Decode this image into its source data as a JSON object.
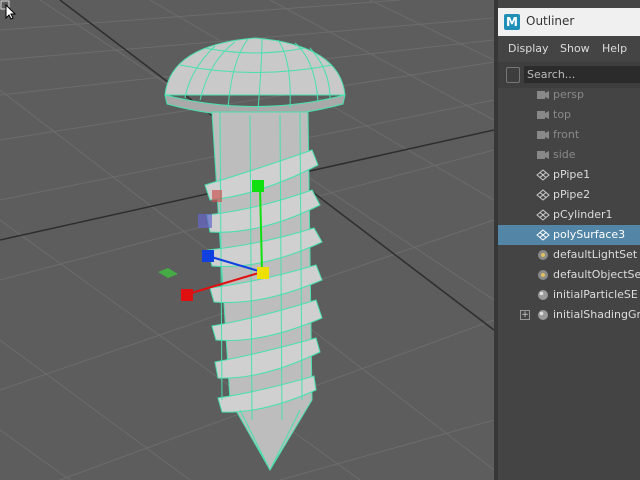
{
  "window": {
    "title": "Outliner",
    "logo_letter": "M"
  },
  "menu": [
    {
      "label": "Display"
    },
    {
      "label": "Show"
    },
    {
      "label": "Help"
    }
  ],
  "search": {
    "placeholder": "Search..."
  },
  "outliner_items": [
    {
      "label": "persp",
      "icon": "camera-icon",
      "type": "camera"
    },
    {
      "label": "top",
      "icon": "camera-icon",
      "type": "camera"
    },
    {
      "label": "front",
      "icon": "camera-icon",
      "type": "camera"
    },
    {
      "label": "side",
      "icon": "camera-icon",
      "type": "camera"
    },
    {
      "label": "pPipe1",
      "icon": "mesh-icon",
      "type": "mesh"
    },
    {
      "label": "pPipe2",
      "icon": "mesh-icon",
      "type": "mesh"
    },
    {
      "label": "pCylinder1",
      "icon": "mesh-icon",
      "type": "mesh"
    },
    {
      "label": "polySurface3",
      "icon": "mesh-icon",
      "type": "mesh",
      "selected": true
    },
    {
      "label": "defaultLightSet",
      "icon": "set-icon",
      "type": "set"
    },
    {
      "label": "defaultObjectSet",
      "icon": "set-icon",
      "type": "set"
    },
    {
      "label": "initialParticleSE",
      "icon": "shading-group-icon",
      "type": "set"
    },
    {
      "label": "initialShadingGroup",
      "icon": "shading-group-icon",
      "type": "set",
      "expandable": true
    }
  ],
  "colors": {
    "selection": "#5285a6",
    "wireframe_highlight": "#49e0b0",
    "viewport_bg": "#5d5d5d",
    "axis_x": "#e01010",
    "axis_y": "#10e010",
    "axis_z": "#1040e0",
    "center_handle": "#f0e000"
  }
}
